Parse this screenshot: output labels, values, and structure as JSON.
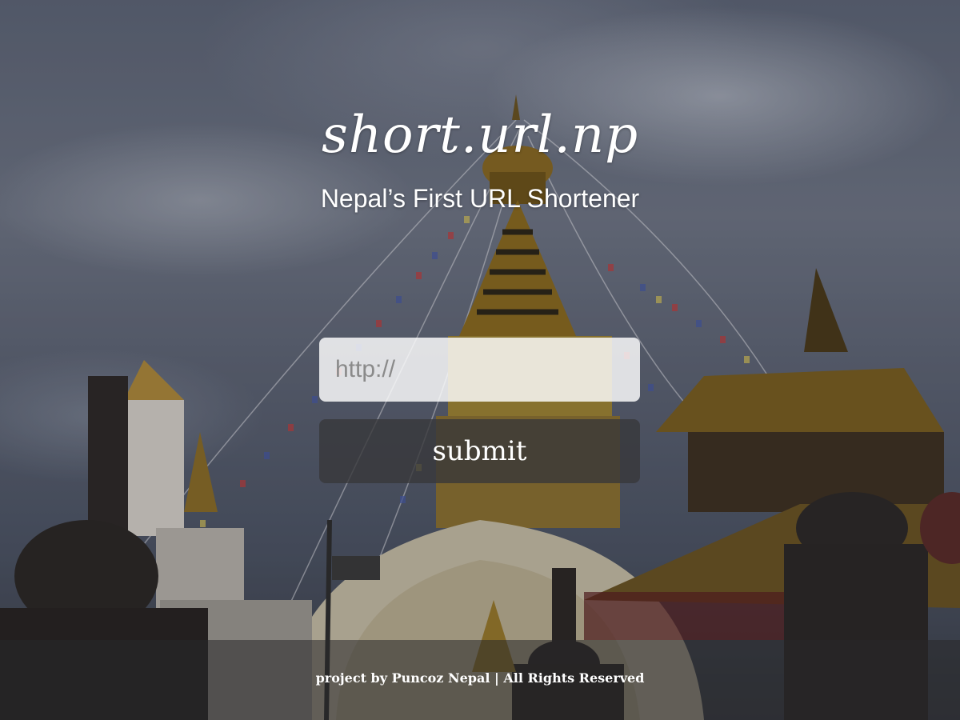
{
  "brand": {
    "title": "short.url.np",
    "subtitle": "Nepal’s First URL Shortener"
  },
  "form": {
    "url_placeholder": "http://",
    "url_value": "",
    "clear_icon": "close-icon",
    "submit_label": "submit"
  },
  "footer": {
    "text": "project by Puncoz Nepal | All Rights Reserved"
  },
  "colors": {
    "text": "#ffffff",
    "input_bg": "#ffffffd1",
    "button_bg": "#37373ac7"
  }
}
